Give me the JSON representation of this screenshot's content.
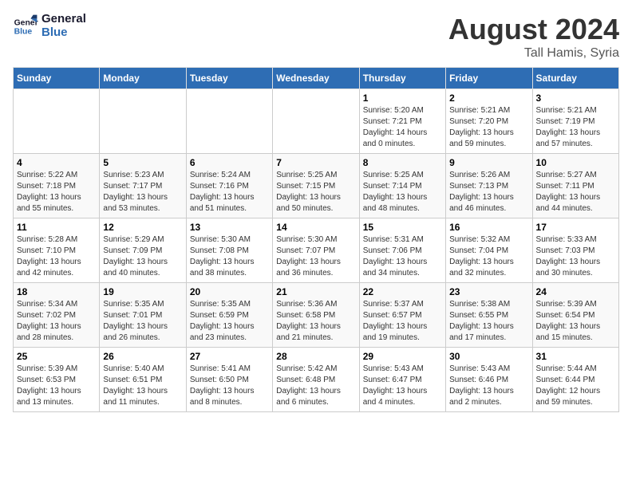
{
  "header": {
    "logo_line1": "General",
    "logo_line2": "Blue",
    "month_title": "August 2024",
    "location": "Tall Hamis, Syria"
  },
  "weekdays": [
    "Sunday",
    "Monday",
    "Tuesday",
    "Wednesday",
    "Thursday",
    "Friday",
    "Saturday"
  ],
  "weeks": [
    [
      {
        "day": "",
        "sunrise": "",
        "sunset": "",
        "daylight": ""
      },
      {
        "day": "",
        "sunrise": "",
        "sunset": "",
        "daylight": ""
      },
      {
        "day": "",
        "sunrise": "",
        "sunset": "",
        "daylight": ""
      },
      {
        "day": "",
        "sunrise": "",
        "sunset": "",
        "daylight": ""
      },
      {
        "day": "1",
        "sunrise": "Sunrise: 5:20 AM",
        "sunset": "Sunset: 7:21 PM",
        "daylight": "Daylight: 14 hours and 0 minutes."
      },
      {
        "day": "2",
        "sunrise": "Sunrise: 5:21 AM",
        "sunset": "Sunset: 7:20 PM",
        "daylight": "Daylight: 13 hours and 59 minutes."
      },
      {
        "day": "3",
        "sunrise": "Sunrise: 5:21 AM",
        "sunset": "Sunset: 7:19 PM",
        "daylight": "Daylight: 13 hours and 57 minutes."
      }
    ],
    [
      {
        "day": "4",
        "sunrise": "Sunrise: 5:22 AM",
        "sunset": "Sunset: 7:18 PM",
        "daylight": "Daylight: 13 hours and 55 minutes."
      },
      {
        "day": "5",
        "sunrise": "Sunrise: 5:23 AM",
        "sunset": "Sunset: 7:17 PM",
        "daylight": "Daylight: 13 hours and 53 minutes."
      },
      {
        "day": "6",
        "sunrise": "Sunrise: 5:24 AM",
        "sunset": "Sunset: 7:16 PM",
        "daylight": "Daylight: 13 hours and 51 minutes."
      },
      {
        "day": "7",
        "sunrise": "Sunrise: 5:25 AM",
        "sunset": "Sunset: 7:15 PM",
        "daylight": "Daylight: 13 hours and 50 minutes."
      },
      {
        "day": "8",
        "sunrise": "Sunrise: 5:25 AM",
        "sunset": "Sunset: 7:14 PM",
        "daylight": "Daylight: 13 hours and 48 minutes."
      },
      {
        "day": "9",
        "sunrise": "Sunrise: 5:26 AM",
        "sunset": "Sunset: 7:13 PM",
        "daylight": "Daylight: 13 hours and 46 minutes."
      },
      {
        "day": "10",
        "sunrise": "Sunrise: 5:27 AM",
        "sunset": "Sunset: 7:11 PM",
        "daylight": "Daylight: 13 hours and 44 minutes."
      }
    ],
    [
      {
        "day": "11",
        "sunrise": "Sunrise: 5:28 AM",
        "sunset": "Sunset: 7:10 PM",
        "daylight": "Daylight: 13 hours and 42 minutes."
      },
      {
        "day": "12",
        "sunrise": "Sunrise: 5:29 AM",
        "sunset": "Sunset: 7:09 PM",
        "daylight": "Daylight: 13 hours and 40 minutes."
      },
      {
        "day": "13",
        "sunrise": "Sunrise: 5:30 AM",
        "sunset": "Sunset: 7:08 PM",
        "daylight": "Daylight: 13 hours and 38 minutes."
      },
      {
        "day": "14",
        "sunrise": "Sunrise: 5:30 AM",
        "sunset": "Sunset: 7:07 PM",
        "daylight": "Daylight: 13 hours and 36 minutes."
      },
      {
        "day": "15",
        "sunrise": "Sunrise: 5:31 AM",
        "sunset": "Sunset: 7:06 PM",
        "daylight": "Daylight: 13 hours and 34 minutes."
      },
      {
        "day": "16",
        "sunrise": "Sunrise: 5:32 AM",
        "sunset": "Sunset: 7:04 PM",
        "daylight": "Daylight: 13 hours and 32 minutes."
      },
      {
        "day": "17",
        "sunrise": "Sunrise: 5:33 AM",
        "sunset": "Sunset: 7:03 PM",
        "daylight": "Daylight: 13 hours and 30 minutes."
      }
    ],
    [
      {
        "day": "18",
        "sunrise": "Sunrise: 5:34 AM",
        "sunset": "Sunset: 7:02 PM",
        "daylight": "Daylight: 13 hours and 28 minutes."
      },
      {
        "day": "19",
        "sunrise": "Sunrise: 5:35 AM",
        "sunset": "Sunset: 7:01 PM",
        "daylight": "Daylight: 13 hours and 26 minutes."
      },
      {
        "day": "20",
        "sunrise": "Sunrise: 5:35 AM",
        "sunset": "Sunset: 6:59 PM",
        "daylight": "Daylight: 13 hours and 23 minutes."
      },
      {
        "day": "21",
        "sunrise": "Sunrise: 5:36 AM",
        "sunset": "Sunset: 6:58 PM",
        "daylight": "Daylight: 13 hours and 21 minutes."
      },
      {
        "day": "22",
        "sunrise": "Sunrise: 5:37 AM",
        "sunset": "Sunset: 6:57 PM",
        "daylight": "Daylight: 13 hours and 19 minutes."
      },
      {
        "day": "23",
        "sunrise": "Sunrise: 5:38 AM",
        "sunset": "Sunset: 6:55 PM",
        "daylight": "Daylight: 13 hours and 17 minutes."
      },
      {
        "day": "24",
        "sunrise": "Sunrise: 5:39 AM",
        "sunset": "Sunset: 6:54 PM",
        "daylight": "Daylight: 13 hours and 15 minutes."
      }
    ],
    [
      {
        "day": "25",
        "sunrise": "Sunrise: 5:39 AM",
        "sunset": "Sunset: 6:53 PM",
        "daylight": "Daylight: 13 hours and 13 minutes."
      },
      {
        "day": "26",
        "sunrise": "Sunrise: 5:40 AM",
        "sunset": "Sunset: 6:51 PM",
        "daylight": "Daylight: 13 hours and 11 minutes."
      },
      {
        "day": "27",
        "sunrise": "Sunrise: 5:41 AM",
        "sunset": "Sunset: 6:50 PM",
        "daylight": "Daylight: 13 hours and 8 minutes."
      },
      {
        "day": "28",
        "sunrise": "Sunrise: 5:42 AM",
        "sunset": "Sunset: 6:48 PM",
        "daylight": "Daylight: 13 hours and 6 minutes."
      },
      {
        "day": "29",
        "sunrise": "Sunrise: 5:43 AM",
        "sunset": "Sunset: 6:47 PM",
        "daylight": "Daylight: 13 hours and 4 minutes."
      },
      {
        "day": "30",
        "sunrise": "Sunrise: 5:43 AM",
        "sunset": "Sunset: 6:46 PM",
        "daylight": "Daylight: 13 hours and 2 minutes."
      },
      {
        "day": "31",
        "sunrise": "Sunrise: 5:44 AM",
        "sunset": "Sunset: 6:44 PM",
        "daylight": "Daylight: 12 hours and 59 minutes."
      }
    ]
  ]
}
